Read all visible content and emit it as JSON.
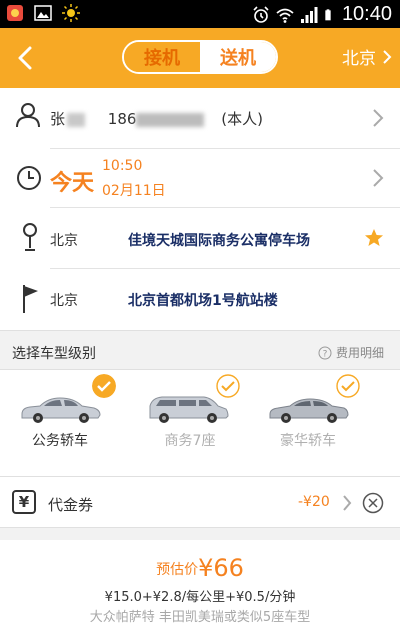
{
  "status_bar": {
    "time": "10:40"
  },
  "header": {
    "back_label": "<",
    "tabs": [
      {
        "label": "接机",
        "active": false
      },
      {
        "label": "送机",
        "active": true
      }
    ],
    "city": "北京"
  },
  "passenger": {
    "name_prefix": "张",
    "phone_prefix": "186",
    "self_tag": "(本人)"
  },
  "departure": {
    "day": "今天",
    "time": "10:50",
    "date": "02月11日"
  },
  "pickup": {
    "city": "北京",
    "place": "佳境天城国际商务公寓停车场"
  },
  "dropoff": {
    "city": "北京",
    "place": "北京首都机场1号航站楼"
  },
  "car_section": {
    "title": "选择车型级别",
    "fee_link": "费用明细"
  },
  "car_types": [
    {
      "label": "公务轿车",
      "selected": true
    },
    {
      "label": "商务7座",
      "selected": false
    },
    {
      "label": "豪华轿车",
      "selected": false
    }
  ],
  "coupon": {
    "icon_char": "¥",
    "label": "代金券",
    "value": "-¥20"
  },
  "estimate": {
    "label": "预估价",
    "price": "¥66",
    "formula": "¥15.0+¥2.8/每公里+¥0.5/分钟",
    "models": "大众帕萨特 丰田凯美瑞或类似5座车型"
  },
  "colors": {
    "accent": "#f7a925",
    "orange_text": "#f58220",
    "navy_text": "#1a2e66"
  }
}
